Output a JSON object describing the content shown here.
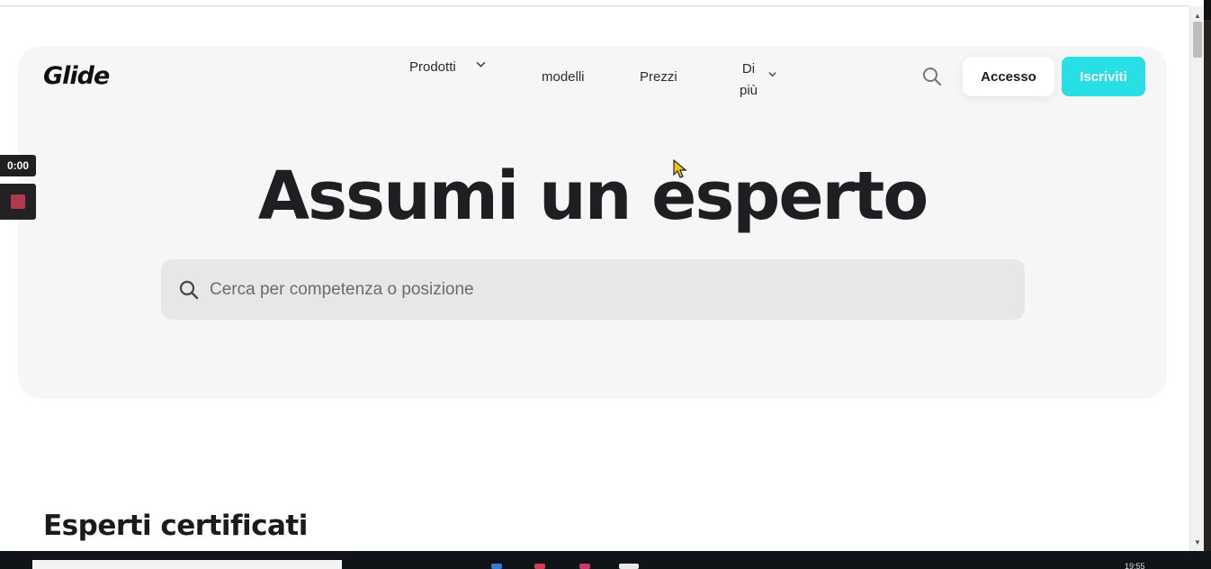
{
  "header": {
    "logo": "Glide",
    "nav": {
      "products": "Prodotti",
      "templates": "modelli",
      "pricing": "Prezzi",
      "more_line1": "Di",
      "more_line2": "più"
    },
    "login_label": "Accesso",
    "signup_label": "Iscriviti"
  },
  "hero": {
    "title": "Assumi un esperto",
    "search_placeholder": "Cerca per competenza o posizione"
  },
  "section": {
    "title": "Esperti certificati"
  },
  "recorder": {
    "time": "0:00"
  },
  "taskbar": {
    "clock": "19:55"
  },
  "colors": {
    "accent": "#29dfe6",
    "hero_bg": "#f6f6f6",
    "search_bg": "#e7e7e7",
    "text_dark": "#1f1f23"
  },
  "icons": [
    "search-icon",
    "chevron-down-icon",
    "stop-icon",
    "cursor-icon"
  ]
}
